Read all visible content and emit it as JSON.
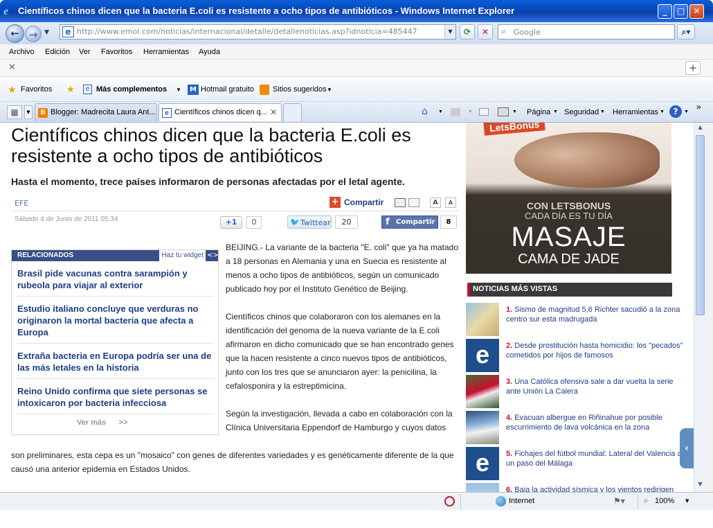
{
  "window": {
    "title": "Científicos chinos dicen que la bacteria E.coli es resistente a ocho tipos de antibióticos - Windows Internet Explorer"
  },
  "address": {
    "url": "http://www.emol.com/noticias/internacional/detalle/detallenoticias.asp?idnoticia=485447"
  },
  "search": {
    "placeholder": "Google"
  },
  "menu": [
    "Archivo",
    "Edición",
    "Ver",
    "Favoritos",
    "Herramientas",
    "Ayuda"
  ],
  "favbar": {
    "favoritos": "Favoritos",
    "mas": "Más complementos",
    "hotmail": "Hotmail gratuito",
    "sitios": "Sitios sugeridos"
  },
  "tabs": [
    {
      "label": "Blogger: Madrecita Laura Ant..."
    },
    {
      "label": "Científicos chinos dicen q..."
    }
  ],
  "commands": {
    "pagina": "Página",
    "seguridad": "Seguridad",
    "herramientas": "Herramientas"
  },
  "article": {
    "headline": "Científicos chinos dicen que la bacteria E.coli es resistente a ocho tipos de antibióticos",
    "lead": "Hasta el momento, trece países informaron de personas afectadas por el letal agente.",
    "source": "EFE",
    "date": "Sábado 4 de Junio de 2011 05:34",
    "share": {
      "compartir": "Compartir",
      "plusone": "+1",
      "plusone_count": "0",
      "twitter": "Twittear",
      "twitter_count": "20",
      "facebook": "Compartir",
      "facebook_count": "8"
    },
    "paragraphs": [
      "BEIJING.- La variante de la bacteria \"E. coli\" que ya ha matado a 18 personas en Alemania y una en Suecia es resistente al menos a ocho tipos de antibióticos, según un comunicado publicado hoy por el Instituto Genético de Beijing.",
      "Científicos chinos que colaboraron con los alemanes en la identificación del genoma de la nueva variante de la E.coli afirmaron en dicho comunicado que se han encontrado genes que la hacen resistente a cinco nuevos tipos de antibióticos, junto con los tres que se anunciaron ayer: la penicilina, la cefalosponira y la estreptimicina.",
      "Según la investigación, llevada a cabo en colaboración con la Clínica Universitaria Eppendorf de Hamburgo y cuyos datos",
      "son preliminares, esta cepa es un \"mosaico\" con genes de diferentes variedades y es genéticamente diferente de la que causó una anterior epidemia en Estados Unidos."
    ]
  },
  "related": {
    "title": "RELACIONADOS",
    "widget": "Haz tu widget",
    "items": [
      "Brasil pide vacunas contra sarampión y rubeola para viajar al exterior",
      "Estudio italiano concluye que verduras no originaron la mortal bacteria que afecta a Europa",
      "Extraña bacteria en Europa podría ser una de las más letales en la historia",
      "Reino Unido confirma que siete personas se intoxicaron por bacteria infecciosa"
    ],
    "more": "Ver más      >>"
  },
  "ad": {
    "brand": "LetsBonus",
    "line1": "CON LETSBONUS",
    "line2": "CADA DÍA ES TU DÍA",
    "line3": "MASAJE",
    "line4": "CAMA DE JADE"
  },
  "most_viewed": {
    "title": "NOTICIAS MÁS VISTAS",
    "items": [
      {
        "n": "1.",
        "text": "Sismo de magnitud 5,6 Richter sacudió a la zona centro sur esta madrugada"
      },
      {
        "n": "2.",
        "text": "Desde prostitución hasta homicidio: los \"pecados\" cometidos por hijos de famosos"
      },
      {
        "n": "3.",
        "text": "Una Católica ofensiva sale a dar vuelta la serie ante Unión La Calera"
      },
      {
        "n": "4.",
        "text": "Evacuan albergue en Riñinahue por posible escurrimiento de lava volcánica en la zona"
      },
      {
        "n": "5.",
        "text": "Fichajes del fútbol mundial: Lateral del Valencia a un paso del Málaga"
      },
      {
        "n": "6.",
        "text": "Baja la actividad sísmica y los vientos redirigen"
      }
    ]
  },
  "status": {
    "zone": "Internet",
    "zoom": "100%"
  }
}
